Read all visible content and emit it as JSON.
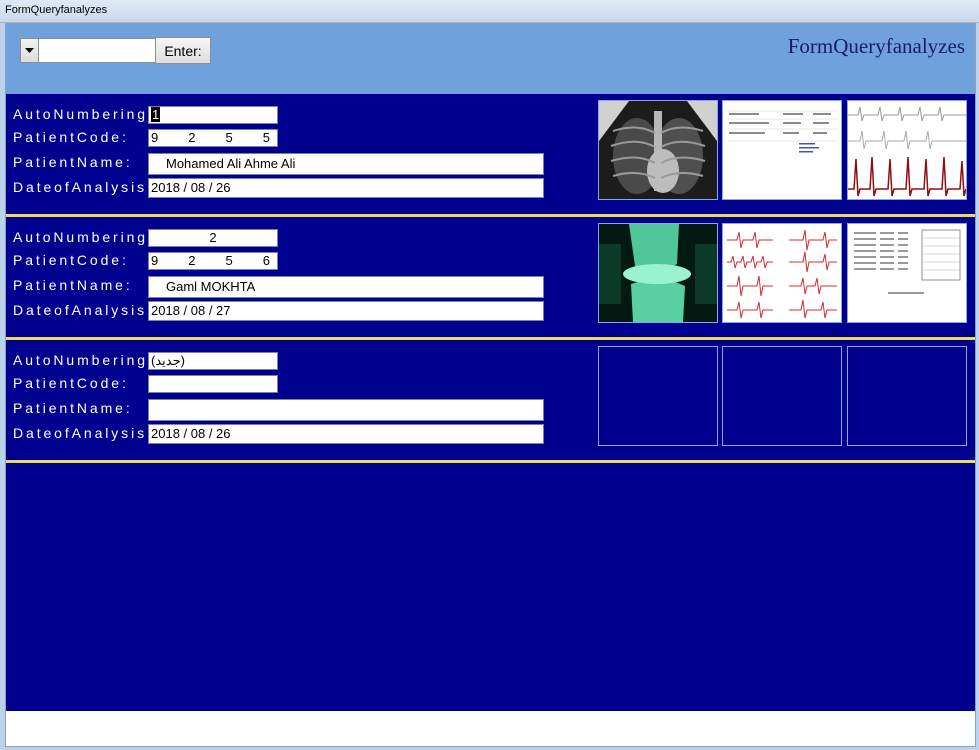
{
  "window": {
    "title": "FormQueryfanalyzes"
  },
  "header": {
    "search_value": "",
    "enter_label": "Enter:",
    "form_title": "FormQueryfanalyzes"
  },
  "labels": {
    "auto_numbering": "AutoNumbering:",
    "patient_code": "PatientCode:",
    "patient_name": "PatientName:",
    "date_of_analysis": "DateofAnalysis:"
  },
  "records": [
    {
      "auto_numbering": "1",
      "patient_code": "9255",
      "patient_name": "Mohamed Ali Ahme Ali",
      "date_of_analysis": "2018 / 08 / 26",
      "images": [
        "chest-xray-image",
        "lab-report-image",
        "ecg-strip-image"
      ]
    },
    {
      "auto_numbering": "2",
      "patient_code": "9256",
      "patient_name": "Gaml MOKHTA",
      "date_of_analysis": "2018 / 08 / 27",
      "images": [
        "knee-xray-image",
        "ecg-leads-image",
        "lab-sheet-image"
      ]
    },
    {
      "auto_numbering": "(جديد)",
      "patient_code": "",
      "patient_name": "",
      "date_of_analysis": "2018 / 08 / 26",
      "images": [
        "empty-image-slot",
        "empty-image-slot",
        "empty-image-slot"
      ]
    }
  ],
  "colors": {
    "header_bg": "#6fa2dc",
    "body_bg": "#00008f",
    "separator": "#f2d85c",
    "title_text": "#1a1a6e"
  }
}
